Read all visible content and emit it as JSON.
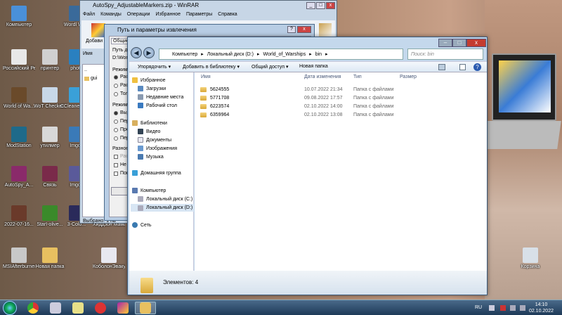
{
  "desktop": {
    "icons": [
      {
        "label": "Компьютер",
        "color": "#4a90d9"
      },
      {
        "label": "Wordl Wa...",
        "color": "#3a6a9a"
      },
      {
        "label": "Российский Реестр",
        "color": "#e8e8e8"
      },
      {
        "label": "принтер",
        "color": "#d0d0d0"
      },
      {
        "label": "photo",
        "color": "#2a80c0"
      },
      {
        "label": "World of Wa...",
        "color": "#6a4a2a"
      },
      {
        "label": "WoT Checker...",
        "color": "#c8d8e8"
      },
      {
        "label": "CCleaner Mo...",
        "color": "#3aa0d8"
      },
      {
        "label": "ModStation",
        "color": "#1e6a8a"
      },
      {
        "label": "утилмер",
        "color": "#d8d8d8"
      },
      {
        "label": "Imgoir",
        "color": "#3a7ab8"
      },
      {
        "label": "AutoSpy_A...",
        "color": "#8a2a6a"
      },
      {
        "label": "Связь",
        "color": "#7a2a4a"
      },
      {
        "label": "Imgoir",
        "color": "#5a5a9a"
      },
      {
        "label": "2022-07-16...",
        "color": "#6a3a2a"
      },
      {
        "label": "StarI-olive...",
        "color": "#3a8a2a"
      },
      {
        "label": "3-Colo...",
        "color": "#2a2a5a"
      },
      {
        "label": "Хиддзон Мамана",
        "color": "#6a6a6a"
      },
      {
        "label": "MSIAfterburnerApi",
        "color": "#c8c8c8"
      },
      {
        "label": "Новая папка",
        "color": "#e8c060"
      },
      {
        "label": "КоболонЭвакуатор",
        "color": "#e8e8f0"
      },
      {
        "label": "Корзина",
        "color": "#d8e0e8"
      }
    ]
  },
  "winrar": {
    "title": "AutoSpy_AdjustableMarkers.zip - WinRAR",
    "menu": [
      "Файл",
      "Команды",
      "Операции",
      "Избранное",
      "Параметры",
      "Справка"
    ],
    "toolbar_add": "Добави",
    "list_header": "Имя",
    "list_items": [
      "..",
      "gui"
    ],
    "status": "Выбрано: 1 па"
  },
  "extract_dialog": {
    "title": "Путь и параметры извлечения",
    "tabs": [
      "Общие",
      "Д"
    ],
    "path_label": "Путь для",
    "path_value": "D:\\World",
    "mode_label": "Режим о",
    "mode_options": [
      "Расп",
      "Расп",
      "Толь"
    ],
    "overwrite_label": "Режим п",
    "overwrite_options": [
      "Выд",
      "Пере",
      "Проп",
      "Пере"
    ],
    "misc_label": "Разное",
    "misc_options": [
      "Расп",
      "Не у",
      "Пока"
    ]
  },
  "explorer": {
    "breadcrumb": [
      "Компьютер",
      "Локальный диск (D:)",
      "World_of_Warships",
      "bin"
    ],
    "search_placeholder": "Поиск: bin",
    "commands": [
      "Упорядочить",
      "Добавить в библиотеку",
      "Общий доступ",
      "Новая папка"
    ],
    "nav": {
      "favorites": "Избранное",
      "downloads": "Загрузки",
      "recent": "Недавние места",
      "desktop": "Рабочий стол",
      "libraries": "Библиотеки",
      "video": "Видео",
      "docs": "Документы",
      "images": "Изображения",
      "music": "Музыка",
      "homegroup": "Домашняя группа",
      "computer": "Компьютер",
      "disk_c": "Локальный диск (C:)",
      "disk_d": "Локальный диск (D:)",
      "network": "Сеть"
    },
    "columns": [
      "Имя",
      "Дата изменения",
      "Тип",
      "Размер"
    ],
    "rows": [
      {
        "name": "5624555",
        "date": "10.07.2022 21:34",
        "type": "Папка с файлами"
      },
      {
        "name": "5771708",
        "date": "09.08.2022 17:57",
        "type": "Папка с файлами"
      },
      {
        "name": "6223574",
        "date": "02.10.2022 14:00",
        "type": "Папка с файлами"
      },
      {
        "name": "6359964",
        "date": "02.10.2022 13:08",
        "type": "Папка с файлами"
      }
    ],
    "status": "Элементов: 4"
  },
  "taskbar": {
    "lang": "RU",
    "time": "14:10",
    "date": "02.10.2022"
  }
}
